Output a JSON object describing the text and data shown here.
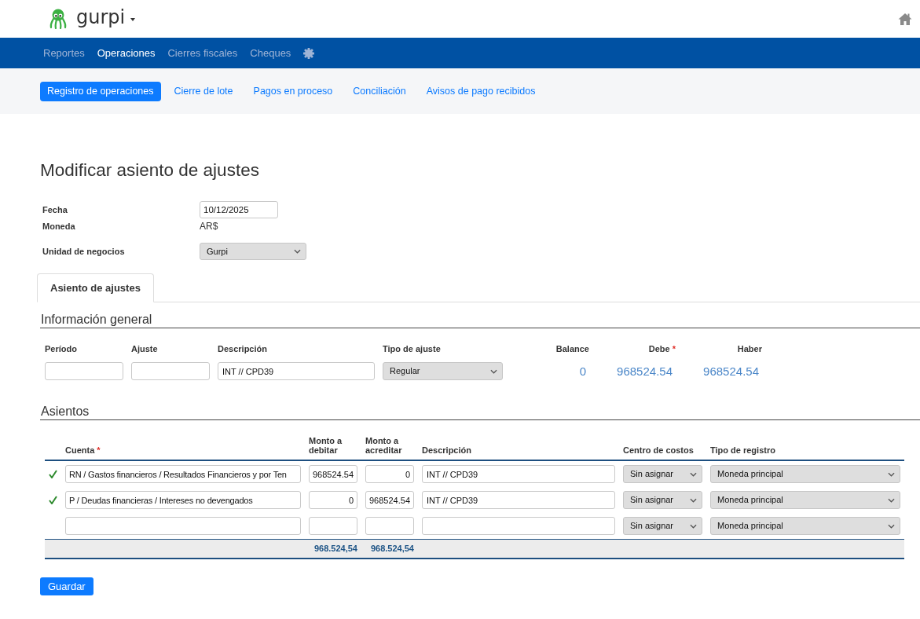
{
  "header": {
    "brand": "gurpi"
  },
  "nav": [
    {
      "label": "Reportes",
      "selected": false
    },
    {
      "label": "Operaciones",
      "selected": true
    },
    {
      "label": "Cierres fiscales",
      "selected": false
    },
    {
      "label": "Cheques",
      "selected": false
    }
  ],
  "subnav": [
    {
      "label": "Registro de operaciones",
      "selected": true
    },
    {
      "label": "Cierre de lote",
      "selected": false
    },
    {
      "label": "Pagos en proceso",
      "selected": false
    },
    {
      "label": "Conciliación",
      "selected": false
    },
    {
      "label": "Avisos de pago recibidos",
      "selected": false
    }
  ],
  "page_title": "Modificar asiento de ajustes",
  "form": [
    {
      "label": "Fecha",
      "kind": "input",
      "value": "10/12/2025"
    },
    {
      "label": "Moneda",
      "kind": "text",
      "value": "AR$"
    },
    {
      "label": "Unidad de negocios",
      "kind": "select",
      "value": "Gurpi"
    }
  ],
  "tabs": [
    {
      "label": "Asiento de ajustes",
      "selected": true
    }
  ],
  "general": {
    "title": "Información general",
    "fields": [
      {
        "label": "Período",
        "kind": "input"
      },
      {
        "label": "Ajuste",
        "kind": "input"
      },
      {
        "label": "Descripción",
        "kind": "input",
        "value": "INT // CPD39"
      },
      {
        "label": "Tipo de ajuste",
        "kind": "select",
        "value": "Regular"
      },
      {
        "label": "Balance",
        "kind": "amount",
        "value": "0"
      },
      {
        "label": "Debe",
        "required_mark": "*",
        "kind": "amount",
        "value": "968524.54"
      },
      {
        "label": "Haber",
        "kind": "amount",
        "value": "968524.54"
      }
    ]
  },
  "asientos": {
    "title": "Asientos",
    "columns": [
      {
        "label": "Cuenta",
        "required_mark": "*"
      },
      {
        "label": "Monto a debitar"
      },
      {
        "label": "Monto a acreditar"
      },
      {
        "label": "Descripción"
      },
      {
        "label": "Centro de costos"
      },
      {
        "label": "Tipo de registro"
      }
    ],
    "rows": [
      {
        "valid": true,
        "cuenta": "RN / Gastos financieros / Resultados Financieros y por Ten",
        "debitar": "968524.54",
        "acreditar": "0",
        "descripcion": "INT // CPD39",
        "centro_de_costos": "Sin asignar",
        "tipo_de_registro": "Moneda principal"
      },
      {
        "valid": true,
        "cuenta": "P / Deudas financieras / Intereses no devengados",
        "debitar": "0",
        "acreditar": "968524.54",
        "descripcion": "INT // CPD39",
        "centro_de_costos": "Sin asignar",
        "tipo_de_registro": "Moneda principal"
      },
      {
        "valid": false,
        "centro_de_costos": "Sin asignar",
        "tipo_de_registro": "Moneda principal"
      }
    ],
    "totals": {
      "debitar": "968.524,54",
      "acreditar": "968.524,54"
    }
  },
  "save_button": "Guardar"
}
